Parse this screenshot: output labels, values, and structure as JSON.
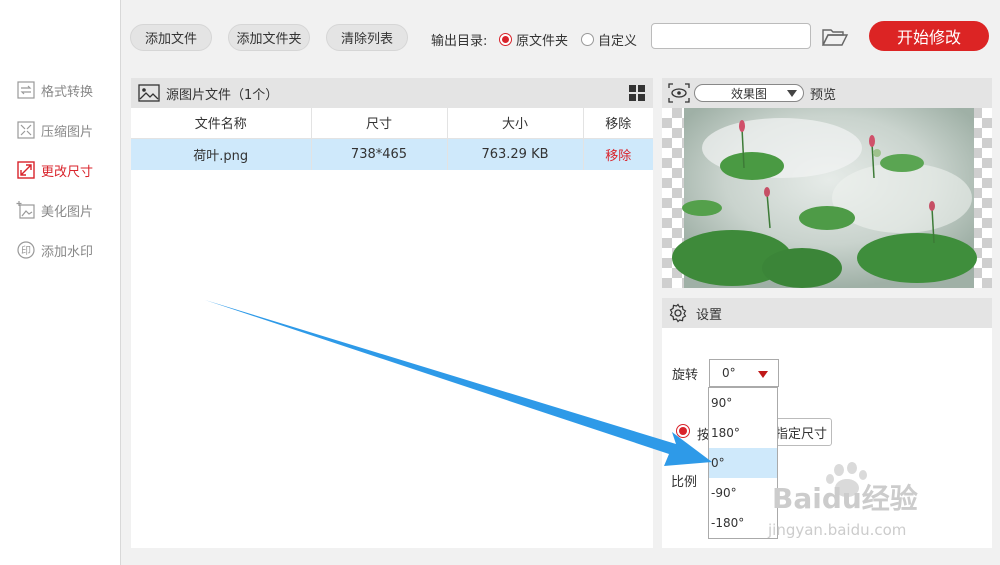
{
  "sidebar": {
    "items": [
      {
        "label": "格式转换",
        "icon": "format-convert-icon",
        "active": false
      },
      {
        "label": "压缩图片",
        "icon": "compress-icon",
        "active": false
      },
      {
        "label": "更改尺寸",
        "icon": "resize-icon",
        "active": true
      },
      {
        "label": "美化图片",
        "icon": "beautify-icon",
        "active": false
      },
      {
        "label": "添加水印",
        "icon": "watermark-stamp-icon",
        "active": false
      }
    ]
  },
  "toolbar": {
    "add_file": "添加文件",
    "add_folder": "添加文件夹",
    "clear_list": "清除列表",
    "output_label": "输出目录:",
    "radio_original": "原文件夹",
    "radio_custom": "自定义",
    "path_value": "",
    "start_button": "开始修改"
  },
  "file_panel": {
    "title": "源图片文件（1个）",
    "columns": [
      "文件名称",
      "尺寸",
      "大小",
      "移除"
    ],
    "rows": [
      {
        "name": "荷叶.png",
        "size": "738*465",
        "filesize": "763.29 KB",
        "action": "移除"
      }
    ]
  },
  "preview": {
    "mode": "效果图",
    "label": "预览"
  },
  "settings": {
    "title": "设置",
    "rotate_label": "旋转",
    "rotate_value": "0°",
    "option1_text": "按",
    "option2_text": "指定尺寸",
    "ratio_label": "比例",
    "rotate_options": [
      "90°",
      "180°",
      "0°",
      "-90°",
      "-180°"
    ],
    "selected_index": 2
  },
  "watermark": {
    "brand": "Baidu经验",
    "url": "jingyan.baidu.com"
  },
  "colors": {
    "accent": "#dc2424",
    "arrow": "#2e9ae8",
    "selection": "#cfe9fb"
  }
}
